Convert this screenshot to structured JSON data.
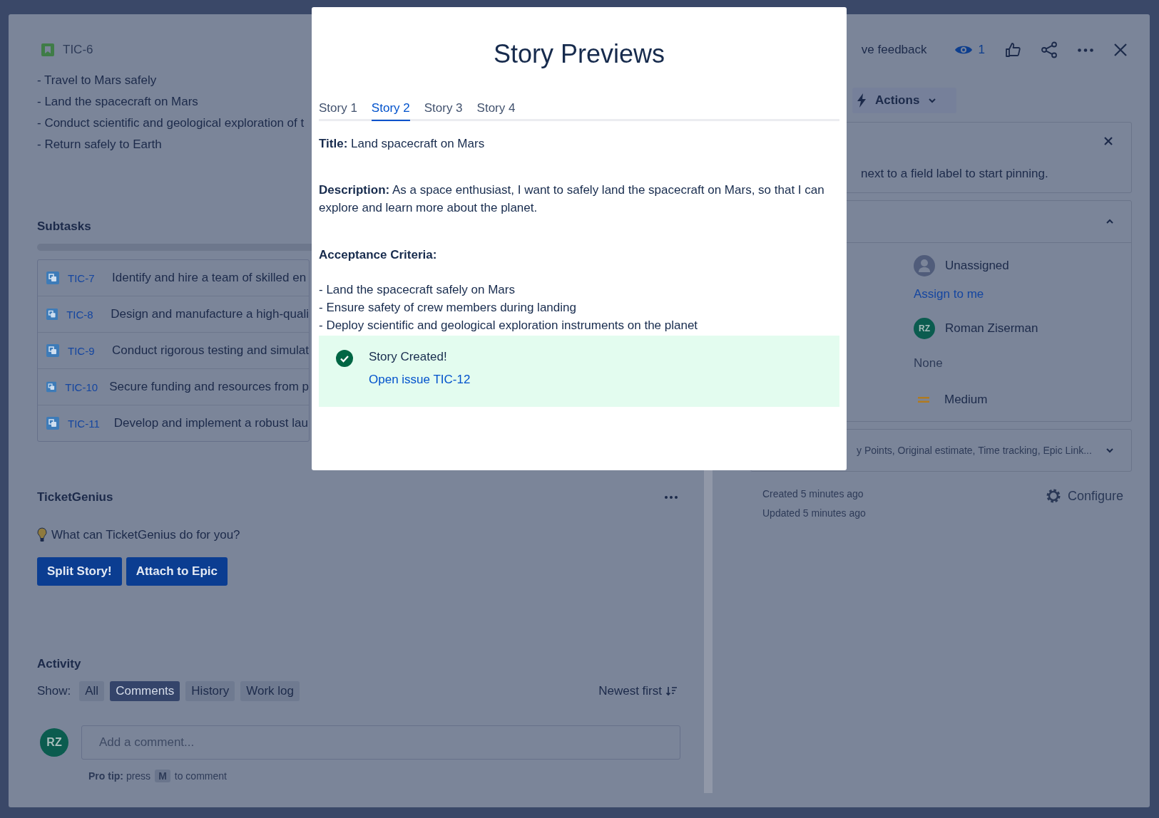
{
  "issue": {
    "key": "TIC-6",
    "description_lines": [
      "- Travel to Mars safely",
      "- Land the spacecraft on Mars",
      "- Conduct scientific and geological exploration of t",
      "- Return safely to Earth"
    ],
    "subtasks": {
      "title": "Subtasks",
      "level": 0,
      "items": [
        {
          "key": "TIC-7",
          "summary": "Identify and hire a team of skilled en"
        },
        {
          "key": "TIC-8",
          "summary": "Design and manufacture a high-quali"
        },
        {
          "key": "TIC-9",
          "summary": "Conduct rigorous testing and simulat"
        },
        {
          "key": "TIC-10",
          "summary": "Secure funding and resources from p"
        },
        {
          "key": "TIC-11",
          "summary": "Develop and implement a robust lau"
        }
      ]
    },
    "ticketgenius": {
      "title": "TicketGenius",
      "prompt": "What can TicketGenius do for you?",
      "buttons": [
        "Split Story!",
        "Attach to Epic"
      ]
    },
    "activity": {
      "title": "Activity",
      "show_label": "Show:",
      "filters": [
        {
          "label": "All",
          "selected": false
        },
        {
          "label": "Comments",
          "selected": true
        },
        {
          "label": "History",
          "selected": false
        },
        {
          "label": "Work log",
          "selected": false
        }
      ],
      "sort": "Newest first",
      "avatar": "RZ",
      "comment_placeholder": "Add a comment...",
      "tip_prefix": "**Pro tip:** press",
      "tip_key": "M",
      "tip_suffix": "to comment"
    }
  },
  "header": {
    "feedback": "ve feedback",
    "watchers": "1"
  },
  "actions": "Actions",
  "pin_hint": "next to a field label to start pinning.",
  "details": {
    "expanded": true,
    "assignee": "Unassigned",
    "assign_link": "Assign to me",
    "reporter_initials": "RZ",
    "reporter": "Roman Ziserman",
    "labels": "None",
    "priority": "Medium"
  },
  "more_fields": {
    "text": "y Points, Original estimate, Time tracking, Epic Link...",
    "expanded": false
  },
  "dates": [
    "Created 5 minutes ago",
    "Updated 5 minutes ago"
  ],
  "configure": "Configure",
  "modal": {
    "title": "Story Previews",
    "tabs": [
      {
        "label": "Story 1",
        "selected": false
      },
      {
        "label": "Story 2",
        "selected": true
      },
      {
        "label": "Story 3",
        "selected": false
      },
      {
        "label": "Story 4",
        "selected": false
      }
    ],
    "story_title": "**Title:** Land spacecraft on Mars",
    "description": "**Description:** As a space enthusiast, I want to safely land the spacecraft on Mars, so that I can explore and learn more about the planet.",
    "criteria_title": "Acceptance Criteria:",
    "criteria": [
      "- Land the spacecraft safely on Mars",
      "- Ensure safety of crew members during landing",
      "- Deploy scientific and geological exploration instruments on the planet"
    ],
    "notice": {
      "text": "Story Created!",
      "link": "Open issue TIC-12"
    }
  }
}
